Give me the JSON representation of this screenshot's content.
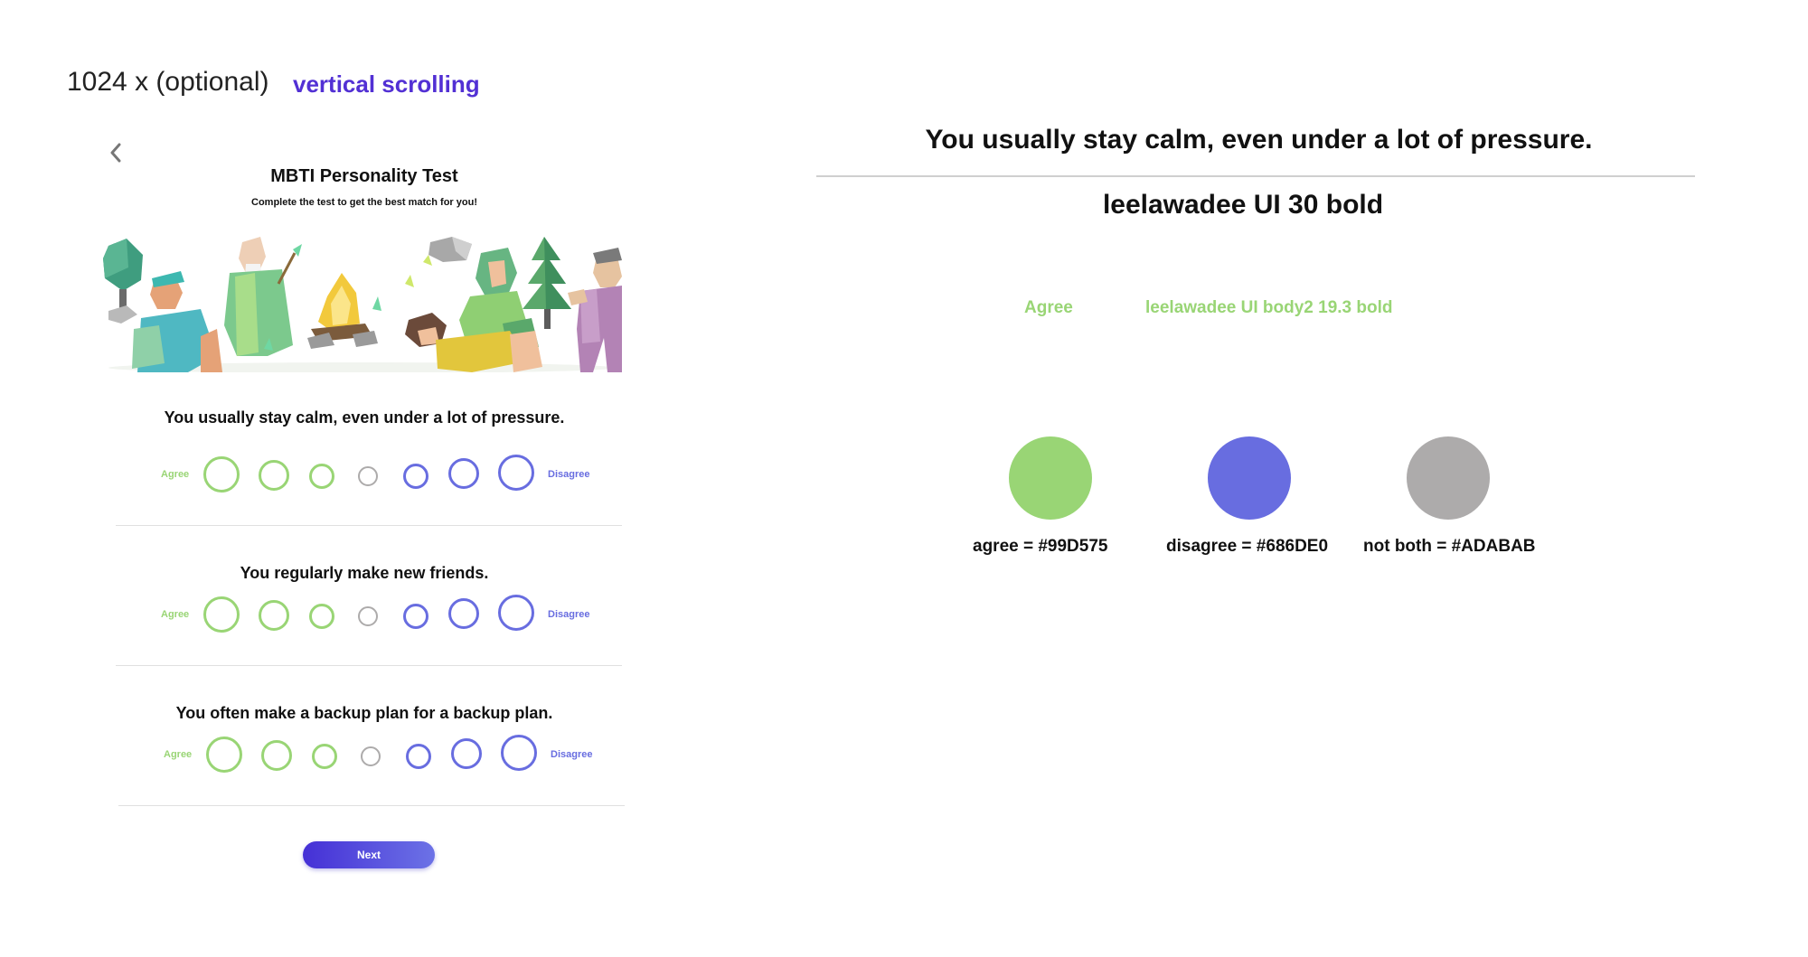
{
  "spec": {
    "size_label": "1024 x (optional)",
    "scroll_label": "vertical scrolling",
    "sample_question": "You usually stay calm, even under a lot of pressure.",
    "font_label": "leelawadee UI 30 bold",
    "agree_sample": "Agree",
    "body_font_label": "leelawadee UI body2  19.3 bold",
    "swatches": [
      {
        "label": "agree = #99D575",
        "color": "#99D575"
      },
      {
        "label": "disagree = #686DE0",
        "color": "#686DE0"
      },
      {
        "label": "not both = #ADABAB",
        "color": "#ADABAB"
      }
    ]
  },
  "app": {
    "title": "MBTI Personality Test",
    "subtitle": "Complete the test to get  the best match for you!",
    "agree_label": "Agree",
    "disagree_label": "Disagree",
    "questions": [
      "You usually stay calm, even under a lot of pressure.",
      "You regularly make new friends.",
      "You often make a backup plan for a backup plan."
    ],
    "next_label": "Next"
  },
  "colors": {
    "agree": "#99D575",
    "disagree": "#686DE0",
    "neutral": "#ADABAB",
    "accent": "#5230D4"
  }
}
